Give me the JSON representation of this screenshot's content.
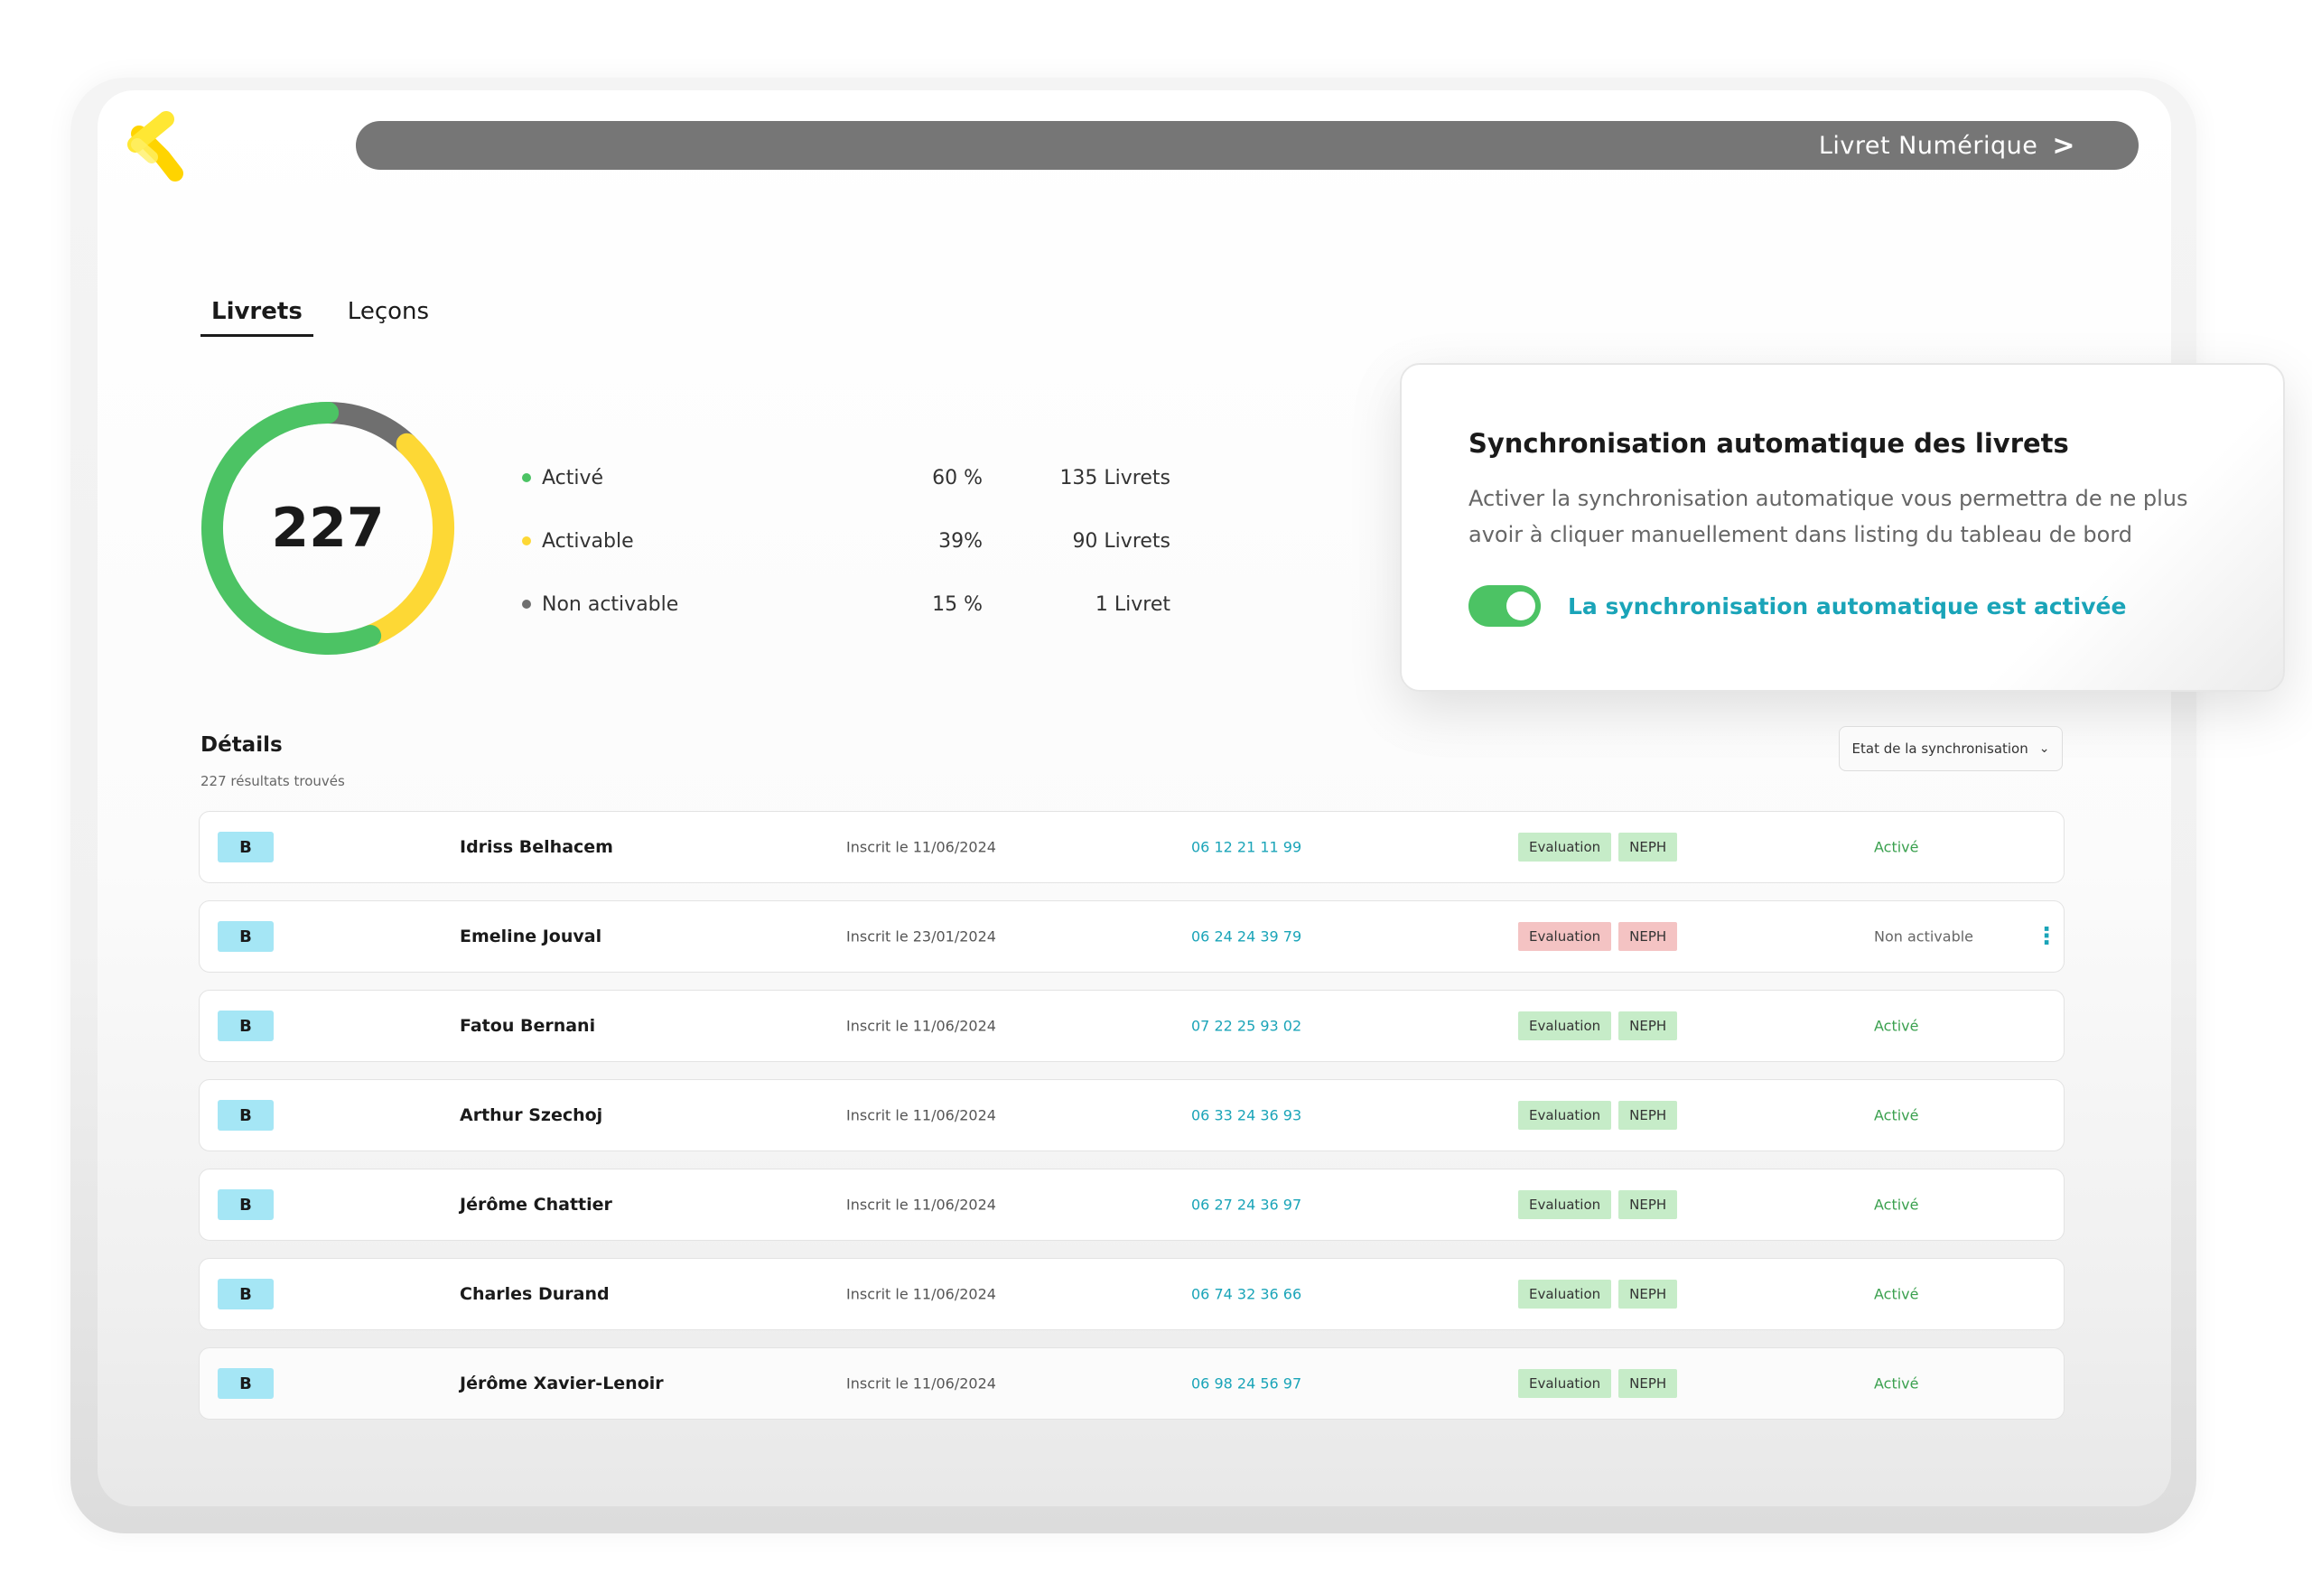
{
  "header": {
    "logo_icon": "k-logo",
    "nav_label": "Livret Numérique",
    "nav_chevron": ">"
  },
  "tabs": [
    {
      "label": "Livrets",
      "active": true
    },
    {
      "label": "Leçons",
      "active": false
    }
  ],
  "summary": {
    "total": "227",
    "segments": [
      {
        "label": "Activé",
        "pct": "60 %",
        "count": "135 Livrets",
        "color": "#4cc364",
        "value": 135
      },
      {
        "label": "Activable",
        "pct": "39%",
        "count": "90 Livrets",
        "color": "#fdd835",
        "value": 90
      },
      {
        "label": "Non activable",
        "pct": "15 %",
        "count": "1 Livret",
        "color": "#6f6f6f",
        "value": 1
      }
    ],
    "donut_display_fractions": {
      "green": 0.56,
      "yellow": 0.32,
      "grey": 0.12
    }
  },
  "sync_card": {
    "title": "Synchronisation automatique des livrets",
    "description": "Activer la synchronisation automatique vous permettra de ne plus avoir à cliquer manuellement dans listing du tableau de bord",
    "toggle_on": true,
    "status": "La synchronisation automatique est activée"
  },
  "details": {
    "title": "Détails",
    "count": "227 résultats trouvés",
    "filter_label": "Etat de la synchronisation",
    "rows": [
      {
        "category": "B",
        "name": "Idriss Belhacem",
        "date": "Inscrit le 11/06/2024",
        "phone": "06 12 21 11 99",
        "badge1": "Evaluation",
        "badge2": "NEPH",
        "badge_color": "green",
        "status": "Activé",
        "status_type": "on"
      },
      {
        "category": "B",
        "name": "Emeline Jouval",
        "date": "Inscrit le 23/01/2024",
        "phone": "06 24 24 39 79",
        "badge1": "Evaluation",
        "badge2": "NEPH",
        "badge_color": "red",
        "status": "Non activable",
        "status_type": "off"
      },
      {
        "category": "B",
        "name": "Fatou Bernani",
        "date": "Inscrit le 11/06/2024",
        "phone": "07 22 25 93 02",
        "badge1": "Evaluation",
        "badge2": "NEPH",
        "badge_color": "green",
        "status": "Activé",
        "status_type": "on"
      },
      {
        "category": "B",
        "name": "Arthur Szechoj",
        "date": "Inscrit le 11/06/2024",
        "phone": "06 33 24 36 93",
        "badge1": "Evaluation",
        "badge2": "NEPH",
        "badge_color": "green",
        "status": "Activé",
        "status_type": "on"
      },
      {
        "category": "B",
        "name": "Jérôme Chattier",
        "date": "Inscrit le 11/06/2024",
        "phone": "06 27 24 36 97",
        "badge1": "Evaluation",
        "badge2": "NEPH",
        "badge_color": "green",
        "status": "Activé",
        "status_type": "on"
      },
      {
        "category": "B",
        "name": "Charles Durand",
        "date": "Inscrit le 11/06/2024",
        "phone": "06 74 32 36 66",
        "badge1": "Evaluation",
        "badge2": "NEPH",
        "badge_color": "green",
        "status": "Activé",
        "status_type": "on"
      },
      {
        "category": "B",
        "name": "Jérôme Xavier-Lenoir",
        "date": "Inscrit le 11/06/2024",
        "phone": "06 98 24 56 97",
        "badge1": "Evaluation",
        "badge2": "NEPH",
        "badge_color": "green",
        "status": "Activé",
        "status_type": "on"
      }
    ]
  },
  "colors": {
    "accent_teal": "#1aa4b8",
    "green": "#4cc364",
    "yellow": "#fdd835",
    "grey": "#6f6f6f",
    "nav_bar": "#767676"
  }
}
